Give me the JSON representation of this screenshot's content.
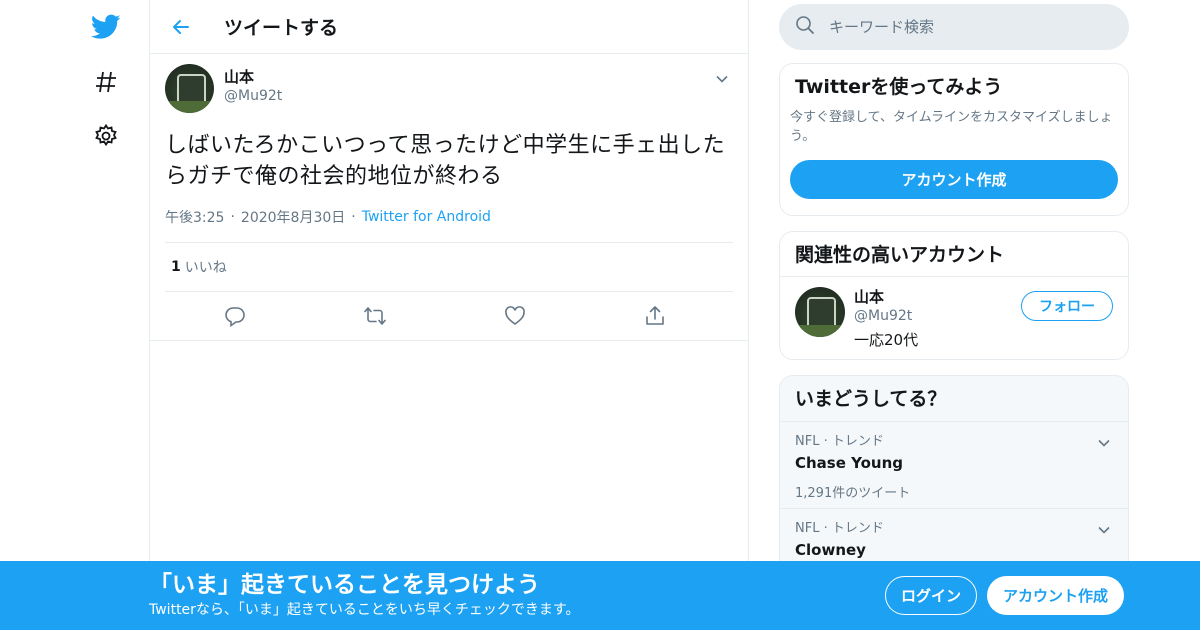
{
  "nav": {
    "icons": [
      "twitter-logo-icon",
      "hashtag-icon",
      "gear-icon"
    ]
  },
  "header": {
    "title": "ツイートする",
    "back_icon": "arrow-left-icon"
  },
  "tweet": {
    "user_name": "山本",
    "user_handle": "@Mu92t",
    "text": "しばいたろかこいつって思ったけど中学生に手ェ出したらガチで俺の社会的地位が終わる",
    "time": "午後3:25",
    "date": "2020年8月30日",
    "source": "Twitter for Android",
    "likes_count": "1",
    "likes_label": "いいね",
    "action_icons": [
      "reply-icon",
      "retweet-icon",
      "like-icon",
      "share-icon"
    ]
  },
  "search": {
    "placeholder": "キーワード検索"
  },
  "signup_card": {
    "title": "Twitterを使ってみよう",
    "description": "今すぐ登録して、タイムラインをカスタマイズしましょう。",
    "button": "アカウント作成"
  },
  "related": {
    "title": "関連性の高いアカウント",
    "user_name": "山本",
    "user_handle": "@Mu92t",
    "bio": "一応20代",
    "follow_button": "フォロー"
  },
  "trends": {
    "title": "いまどうしてる？",
    "items": [
      {
        "context": "NFL · トレンド",
        "name": "Chase Young",
        "count": "1,291件のツイート"
      },
      {
        "context": "NFL · トレンド",
        "name": "Clowney",
        "count": ""
      }
    ]
  },
  "banner": {
    "title": "「いま」起きていることを見つけよう",
    "subtitle": "Twitterなら、「いま」起きていることをいち早くチェックできます。",
    "login_button": "ログイン",
    "signup_button": "アカウント作成"
  },
  "colors": {
    "accent": "#1da1f2",
    "text_secondary": "#657786",
    "border": "#e6ecf0"
  }
}
